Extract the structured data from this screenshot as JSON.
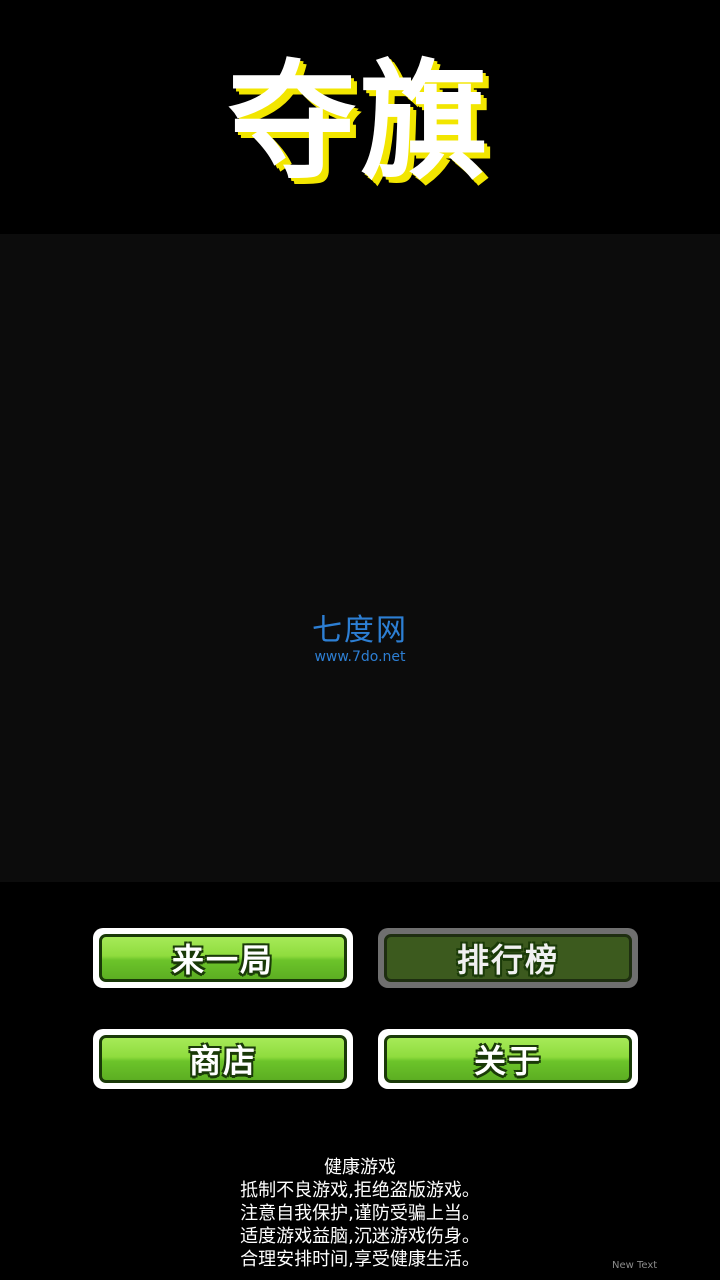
{
  "title": "夺旗",
  "watermark": {
    "name": "七度网",
    "url": "www.7do.net"
  },
  "menu": {
    "play_label": "来一局",
    "rank_label": "排行榜",
    "shop_label": "商店",
    "about_label": "关于"
  },
  "notice": {
    "heading": "健康游戏",
    "lines": [
      "抵制不良游戏,拒绝盗版游戏。",
      "注意自我保护,谨防受骗上当。",
      "适度游戏益脑,沉迷游戏伤身。",
      "合理安排时间,享受健康生活。"
    ]
  },
  "debug_label": "New Text",
  "colors": {
    "background": "#000000",
    "title_shadow": "#f2e600",
    "button_green": "#8fdc3e",
    "button_dim": "#3c5a1e",
    "watermark_blue": "#2d7fd4"
  }
}
